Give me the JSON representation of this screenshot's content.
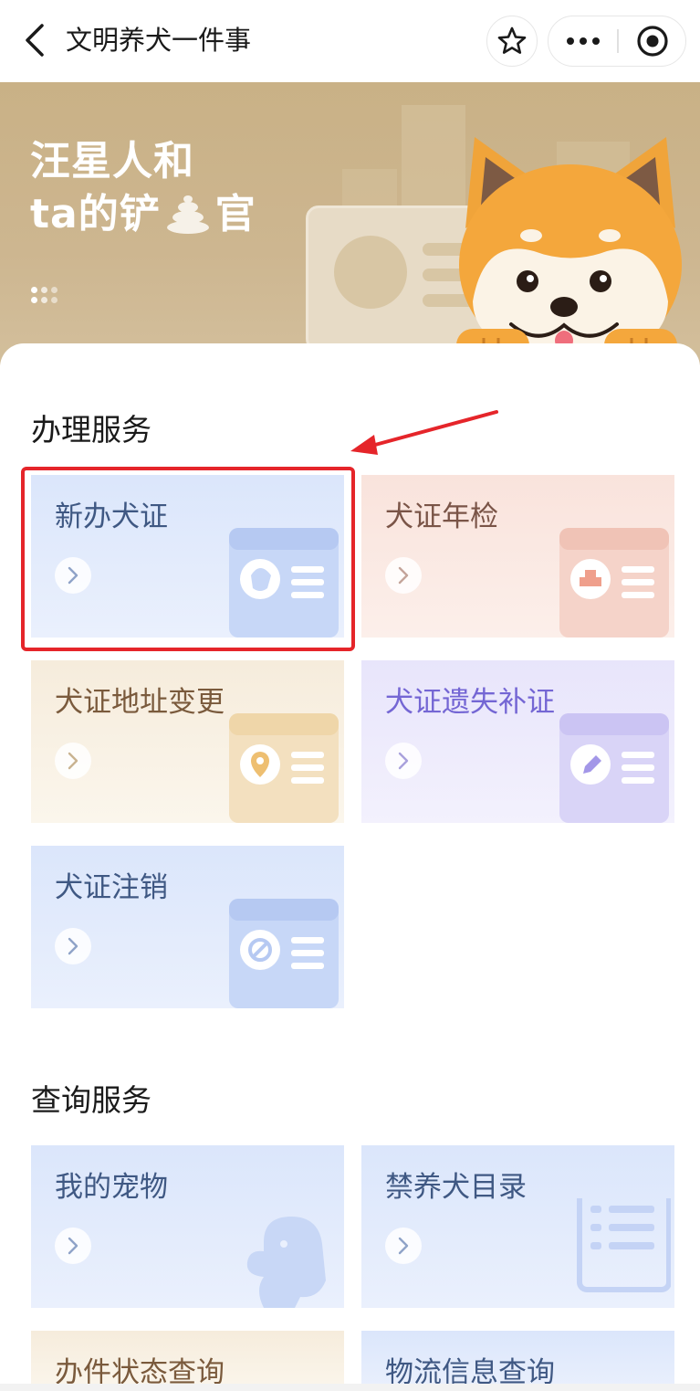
{
  "nav": {
    "title": "文明养犬一件事"
  },
  "banner": {
    "title_line1": "汪星人和",
    "title_line2": "ta的铲",
    "title_line2_end": "官"
  },
  "sections": {
    "handle": {
      "title": "办理服务",
      "tiles": [
        {
          "label": "新办犬证",
          "icon": "dog-face-card-icon",
          "theme": "blue"
        },
        {
          "label": "犬证年检",
          "icon": "stamp-card-icon",
          "theme": "pink"
        },
        {
          "label": "犬证地址变更",
          "icon": "location-card-icon",
          "theme": "tan"
        },
        {
          "label": "犬证遗失补证",
          "icon": "pencil-card-icon",
          "theme": "purple"
        },
        {
          "label": "犬证注销",
          "icon": "cancel-card-icon",
          "theme": "blue"
        }
      ]
    },
    "query": {
      "title": "查询服务",
      "tiles": [
        {
          "label": "我的宠物",
          "icon": "dog-silhouette-icon",
          "theme": "blue"
        },
        {
          "label": "禁养犬目录",
          "icon": "document-list-icon",
          "theme": "blue"
        },
        {
          "label": "办件状态查询",
          "icon": "status-icon",
          "theme": "tan"
        },
        {
          "label": "物流信息查询",
          "icon": "logistics-icon",
          "theme": "blue"
        }
      ]
    }
  },
  "annotation": {
    "highlighted_tile": "新办犬证",
    "color": "#e5252a"
  }
}
